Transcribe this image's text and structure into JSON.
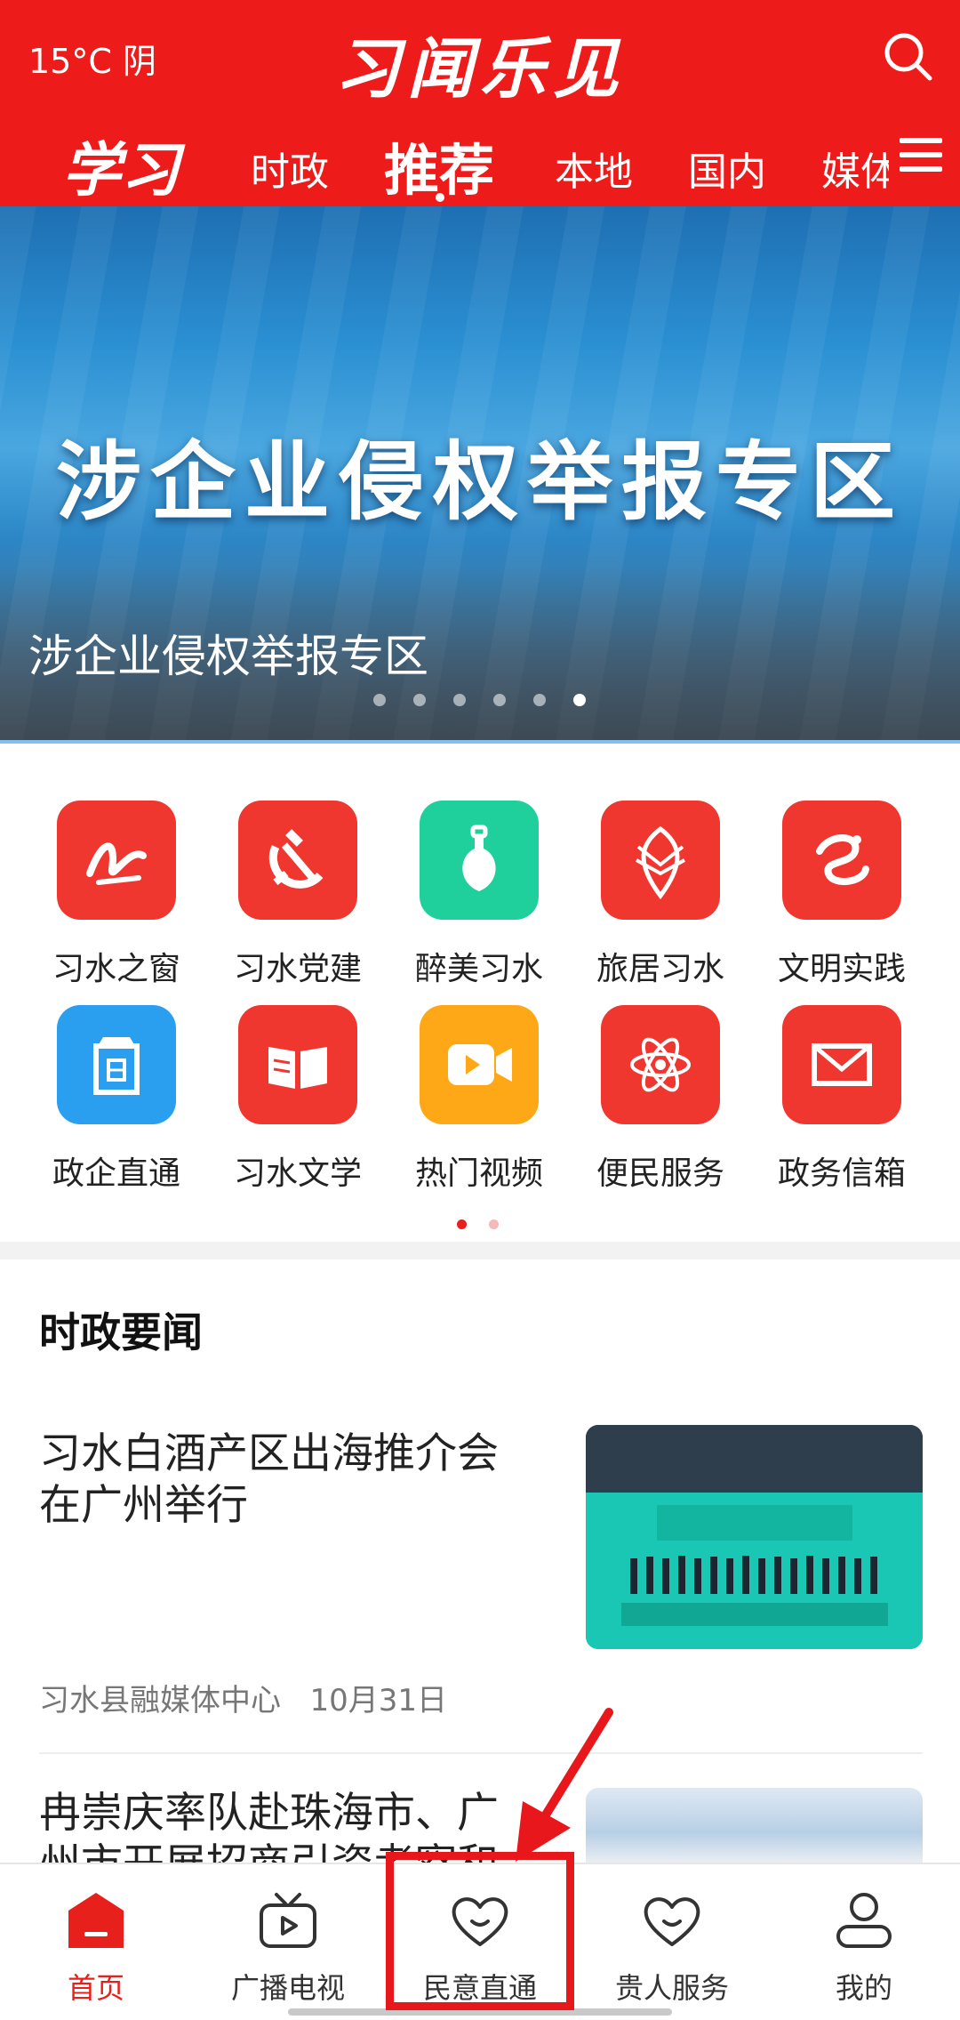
{
  "header": {
    "weather": "15°C 阴",
    "brand": "习闻乐见",
    "xuexi_logo": "学习",
    "tabs": [
      {
        "label": "时政",
        "active": false
      },
      {
        "label": "推荐",
        "active": true
      },
      {
        "label": "本地",
        "active": false
      },
      {
        "label": "国内",
        "active": false
      },
      {
        "label": "媒体",
        "active": false
      }
    ],
    "icons": {
      "search": "search-icon",
      "menu": "menu-icon"
    }
  },
  "banner": {
    "headline": "涉企业侵权举报专区",
    "caption": "涉企业侵权举报专区",
    "slide_count": 6,
    "active_slide": 6
  },
  "quick_links": [
    {
      "label": "习水之窗",
      "icon": "xishui-window-icon",
      "color": "#f0372f"
    },
    {
      "label": "习水党建",
      "icon": "hammer-sickle-icon",
      "color": "#f0372f"
    },
    {
      "label": "醉美习水",
      "icon": "wine-bottle-icon",
      "color": "#1fcf9c"
    },
    {
      "label": "旅居习水",
      "icon": "fish-emblem-icon",
      "color": "#f0372f"
    },
    {
      "label": "文明实践",
      "icon": "civilization-icon",
      "color": "#f0372f"
    },
    {
      "label": "政企直通",
      "icon": "building-icon",
      "color": "#2a9ff0"
    },
    {
      "label": "习水文学",
      "icon": "book-icon",
      "color": "#f0372f"
    },
    {
      "label": "热门视频",
      "icon": "video-camera-icon",
      "color": "#ffa817"
    },
    {
      "label": "便民服务",
      "icon": "atom-icon",
      "color": "#f0372f"
    },
    {
      "label": "政务信箱",
      "icon": "mail-icon",
      "color": "#f0372f"
    }
  ],
  "quick_links_pages": {
    "count": 2,
    "active": 1
  },
  "news_section": {
    "title": "时政要闻",
    "items": [
      {
        "title": "习水白酒产区出海推介会在广州举行",
        "source": "习水县融媒体中心",
        "date": "10月31日"
      },
      {
        "title": "冉崇庆率队赴珠海市、广州市开展招商引资考察和",
        "source": "",
        "date": ""
      }
    ]
  },
  "bottom_nav": [
    {
      "label": "首页",
      "icon": "home-icon",
      "active": true
    },
    {
      "label": "广播电视",
      "icon": "tv-icon",
      "active": false
    },
    {
      "label": "民意直通",
      "icon": "heart-icon",
      "active": false
    },
    {
      "label": "贵人服务",
      "icon": "heart-icon",
      "active": false
    },
    {
      "label": "我的",
      "icon": "user-icon",
      "active": false
    }
  ],
  "colors": {
    "brand_red": "#ee1b1b",
    "active_nav": "#e8201c",
    "annotation": "#e8171c"
  }
}
